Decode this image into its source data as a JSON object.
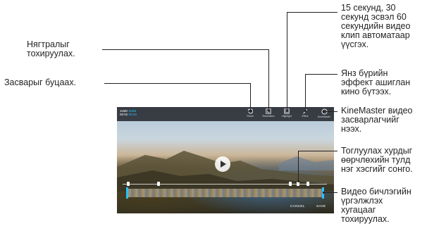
{
  "screen": {
    "time_info": {
      "line1_a": "11M6",
      "line1_b": "11M6",
      "line2_a": "00:02",
      "line2_b": "00:23"
    },
    "toolbar": [
      {
        "icon": "undo-icon",
        "label": "Reset"
      },
      {
        "icon": "resolution-icon",
        "label": "Resolution"
      },
      {
        "icon": "highlight-icon",
        "label": "Highlight"
      },
      {
        "icon": "magic-wand-icon",
        "label": "Effect"
      },
      {
        "icon": "kinemaster-icon",
        "label": "KineMaster"
      }
    ],
    "bottom_buttons": {
      "cancel": "CANCEL",
      "save": "SAVE"
    },
    "colors": {
      "accent": "#27c3ff",
      "toolbar_bg": "#141419"
    }
  },
  "callouts": {
    "resolution": [
      "Нягтралыг",
      "тохируулах."
    ],
    "undo": [
      "Засварыг буцаах."
    ],
    "highlight_clip": [
      "15 секунд, 30",
      "секунд эсвэл 60",
      "секундийн видео",
      "клип автоматаар",
      "үүсгэх."
    ],
    "effect": [
      "Янз бүрийн",
      "эффект ашиглан",
      "кино бүтээх."
    ],
    "kinemaster": [
      "KineMaster видео",
      "засварлагчийг",
      "нээх."
    ],
    "speed": [
      "Тоглуулах хурдыг",
      "өөрчлөхийн тулд",
      "нэг хэсгийг сонго."
    ],
    "trim": [
      "Видео бичлэгийн",
      "үргэлжлэх",
      "хугацааг",
      "тохируулах."
    ]
  }
}
